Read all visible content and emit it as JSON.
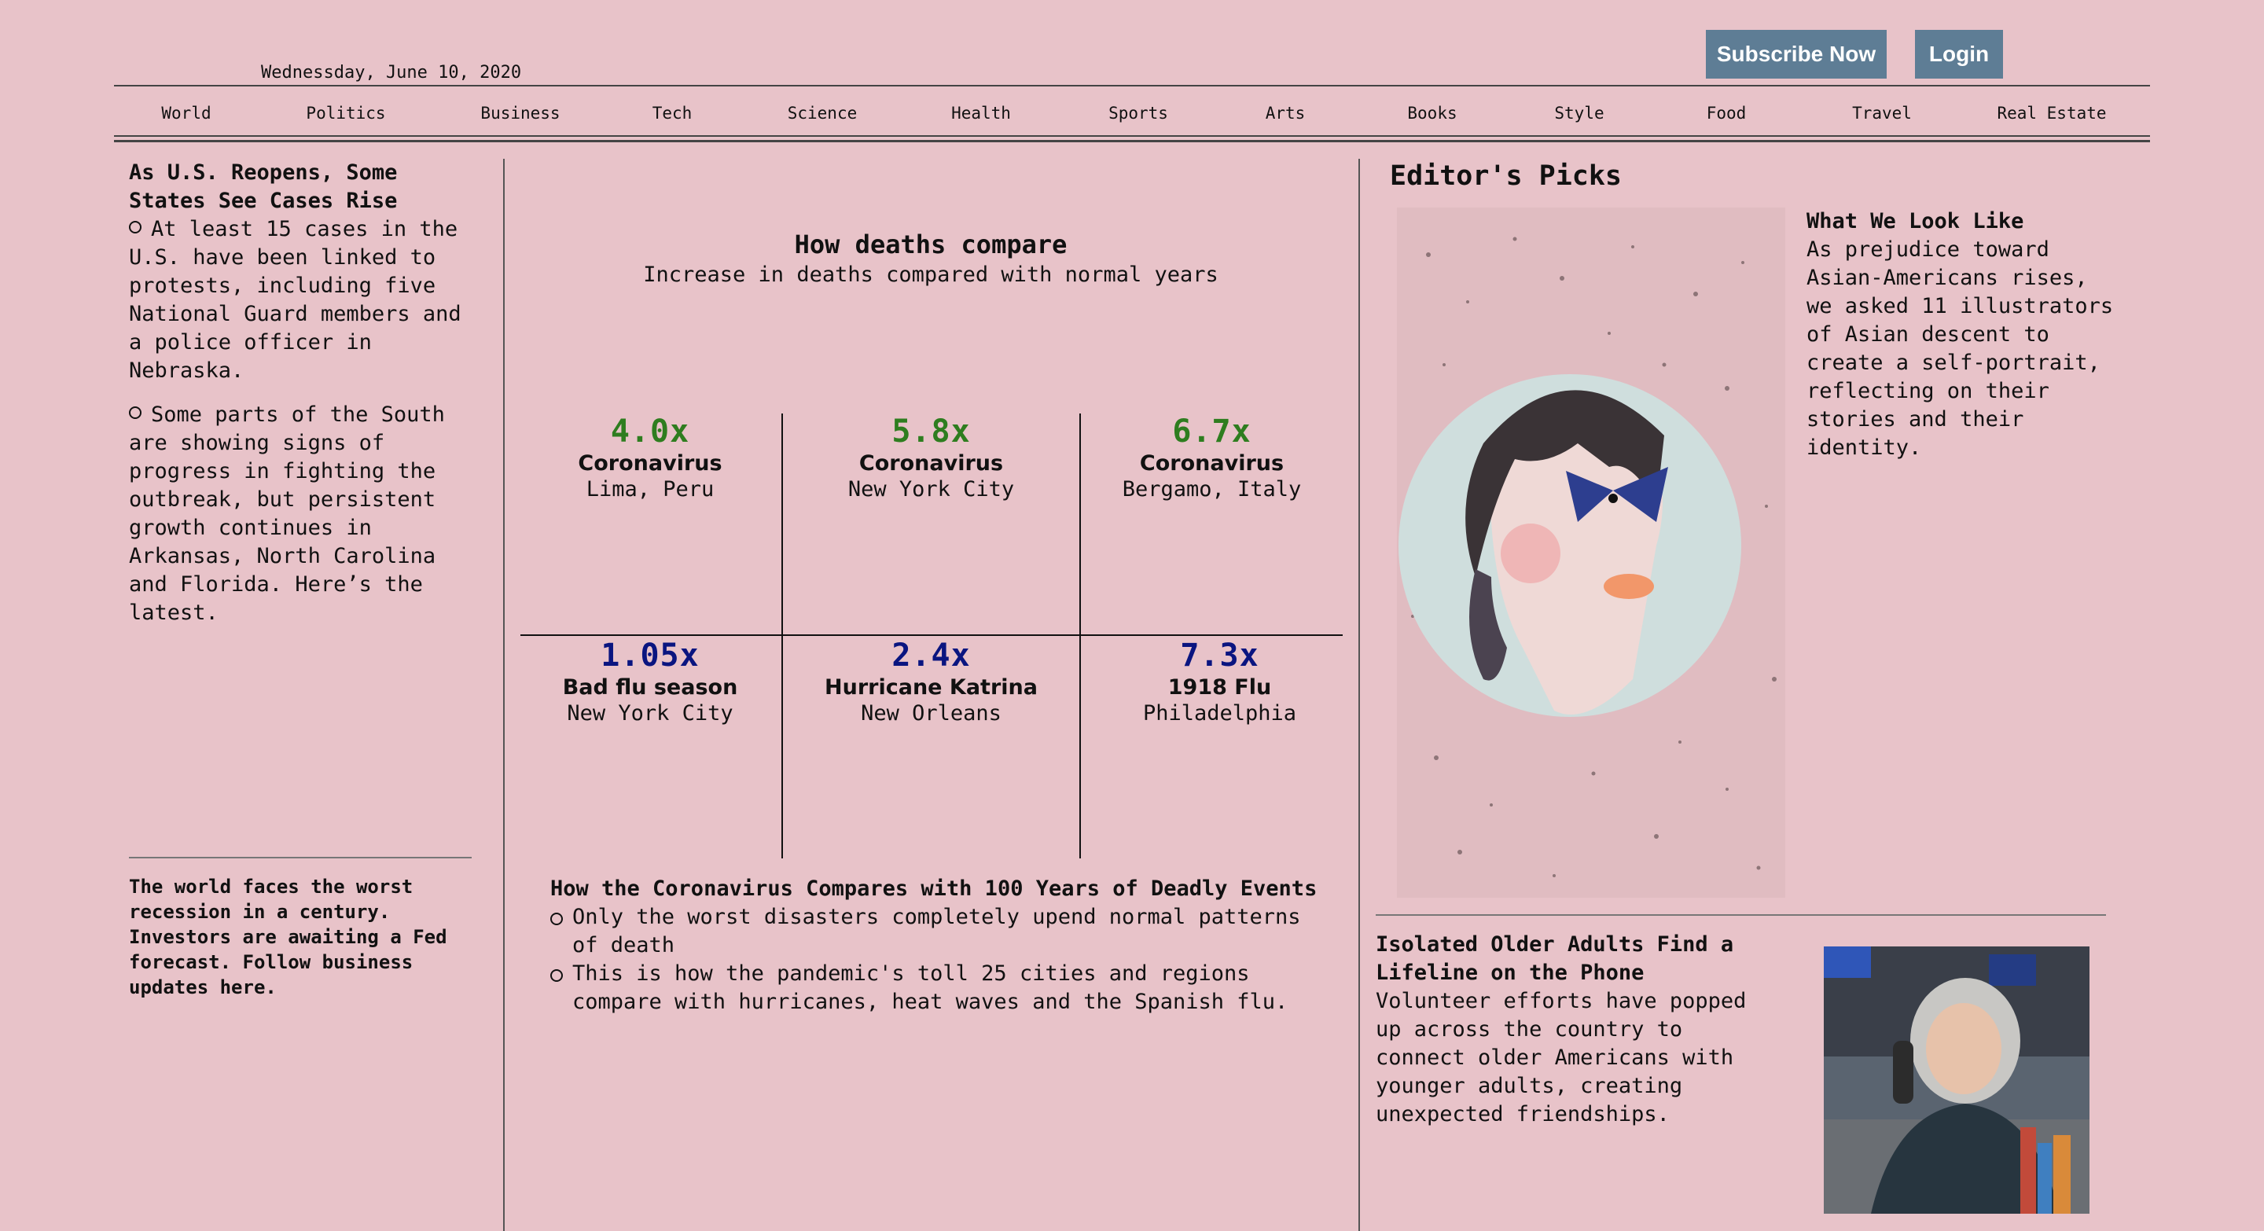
{
  "header": {
    "date": "Wednessday, June 10, 2020",
    "subscribe_label": "Subscribe Now",
    "login_label": "Login",
    "button_color": "#5e7d95"
  },
  "nav": [
    "World",
    "Politics",
    "Business",
    "Tech",
    "Science",
    "Health",
    "Sports",
    "Arts",
    "Books",
    "Style",
    "Food",
    "Travel",
    "Real Estate"
  ],
  "left": {
    "headline": "As U.S. Reopens, Some States See Cases Rise",
    "bullets": [
      "At least 15 cases in the U.S. have been linked to protests, including five National Guard members and a police officer in Nebraska.",
      "Some parts of the South are showing signs of progress in fighting the outbreak, but persistent growth continues in Arkansas, North Carolina and Florida. Here’s the latest."
    ],
    "bottom_story": "The world faces the worst recession in a century. Investors are awaiting a Fed forecast. Follow business updates here."
  },
  "compare": {
    "title": "How deaths compare",
    "subtitle": "Increase in deaths compared with normal years",
    "top_color": "#2e7d1f",
    "bottom_color": "#0a1580",
    "cells": [
      {
        "mult": "4.0x",
        "event": "Coronavirus",
        "place": "Lima, Peru"
      },
      {
        "mult": "5.8x",
        "event": "Coronavirus",
        "place": "New York City"
      },
      {
        "mult": "6.7x",
        "event": "Coronavirus",
        "place": "Bergamo, Italy"
      },
      {
        "mult": "1.05x",
        "event": "Bad flu season",
        "place": "New York City"
      },
      {
        "mult": "2.4x",
        "event": "Hurricane Katrina",
        "place": "New Orleans"
      },
      {
        "mult": "7.3x",
        "event": "1918 Flu",
        "place": "Philadelphia"
      }
    ],
    "story_title": "How the Coronavirus Compares with 100 Years of Deadly Events",
    "story_bullets": [
      "Only the worst disasters completely upend normal patterns of death",
      "This is how the pandemic's toll 25 cities and regions compare with hurricanes, heat waves and the Spanish flu."
    ]
  },
  "editors": {
    "heading": "Editor's Picks",
    "pick1_title": "What We Look Like",
    "pick1_body": "As prejudice toward Asian-Americans rises, we asked 11 illustrators of Asian descent to create a self-portrait, reflecting on their stories and their identity.",
    "pick2_title": "Isolated Older Adults Find a Lifeline on the Phone",
    "pick2_body": "Volunteer efforts have popped up across the country to connect older Americans with younger adults, creating unexpected friendships."
  }
}
